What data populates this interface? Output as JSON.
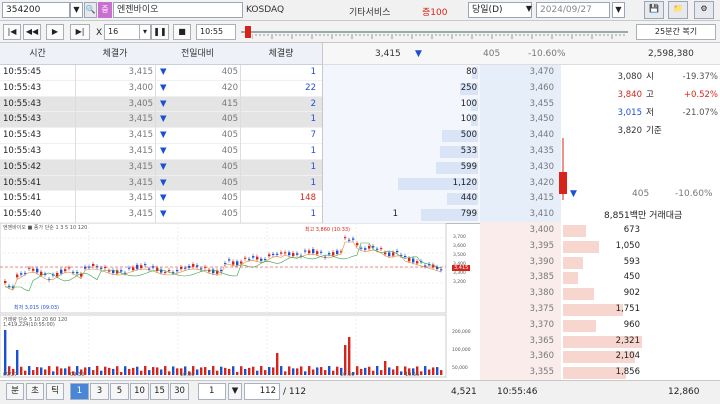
{
  "top": {
    "code": "354200",
    "badge": "중",
    "stock_name": "엔젠바이오",
    "market": "KOSDAQ",
    "sector": "기타서비스",
    "credit": "증100",
    "period": "당일(D)",
    "date": "2024/09/27"
  },
  "ctrl": {
    "multiplier_prefix": "X",
    "multiplier": "16",
    "time_value": "10:55",
    "restore_label": "25분간 복기"
  },
  "ticks": {
    "headers": [
      "시간",
      "체결가",
      "전일대비",
      "체결량"
    ],
    "rows": [
      {
        "time": "10:55:45",
        "price": "3,415",
        "dir": "▼",
        "change": "405",
        "vol": "1",
        "vol_color": "blue"
      },
      {
        "time": "10:55:43",
        "price": "3,400",
        "dir": "▼",
        "change": "420",
        "vol": "22",
        "vol_color": "blue"
      },
      {
        "time": "10:55:43",
        "price": "3,405",
        "dir": "▼",
        "change": "415",
        "vol": "2",
        "vol_color": "blue"
      },
      {
        "time": "10:55:43",
        "price": "3,415",
        "dir": "▼",
        "change": "405",
        "vol": "1",
        "vol_color": "blue"
      },
      {
        "time": "10:55:43",
        "price": "3,415",
        "dir": "▼",
        "change": "405",
        "vol": "7",
        "vol_color": "blue"
      },
      {
        "time": "10:55:43",
        "price": "3,415",
        "dir": "▼",
        "change": "405",
        "vol": "1",
        "vol_color": "blue"
      },
      {
        "time": "10:55:42",
        "price": "3,415",
        "dir": "▼",
        "change": "405",
        "vol": "1",
        "vol_color": "blue"
      },
      {
        "time": "10:55:41",
        "price": "3,415",
        "dir": "▼",
        "change": "405",
        "vol": "1",
        "vol_color": "blue"
      },
      {
        "time": "10:55:41",
        "price": "3,415",
        "dir": "▼",
        "change": "405",
        "vol": "148",
        "vol_color": "red"
      },
      {
        "time": "10:55:40",
        "price": "3,415",
        "dir": "▼",
        "change": "405",
        "vol": "1",
        "vol_color": "blue"
      }
    ]
  },
  "orderbook": {
    "header": {
      "price": "3,415",
      "dir": "▼",
      "change": "405",
      "rate": "-10.60%",
      "volume": "2,598,380"
    },
    "asks": [
      {
        "qty": "80",
        "price": "3,470",
        "pct": 0.07
      },
      {
        "qty": "250",
        "price": "3,460",
        "pct": 0.22
      },
      {
        "qty": "100",
        "price": "3,455",
        "pct": 0.09
      },
      {
        "qty": "100",
        "price": "3,450",
        "pct": 0.09
      },
      {
        "qty": "500",
        "price": "3,440",
        "pct": 0.45
      },
      {
        "qty": "533",
        "price": "3,435",
        "pct": 0.48
      },
      {
        "qty": "599",
        "price": "3,430",
        "pct": 0.53
      },
      {
        "qty": "1,120",
        "price": "3,420",
        "pct": 1.0
      },
      {
        "qty": "440",
        "price": "3,415",
        "pct": 0.39
      },
      {
        "qty": "799",
        "price": "3,410",
        "pct": 0.71,
        "left_qty": "1"
      }
    ],
    "bids": [
      {
        "price": "3,400",
        "qty": "673",
        "pct": 0.29
      },
      {
        "price": "3,395",
        "qty": "1,050",
        "pct": 0.45
      },
      {
        "price": "3,390",
        "qty": "593",
        "pct": 0.25
      },
      {
        "price": "3,385",
        "qty": "450",
        "pct": 0.19
      },
      {
        "price": "3,380",
        "qty": "902",
        "pct": 0.39
      },
      {
        "price": "3,375",
        "qty": "1,751",
        "pct": 0.75
      },
      {
        "price": "3,370",
        "qty": "960",
        "pct": 0.41
      },
      {
        "price": "3,365",
        "qty": "2,321",
        "pct": 0.99
      },
      {
        "price": "3,360",
        "qty": "2,104",
        "pct": 0.9
      },
      {
        "price": "3,355",
        "qty": "1,856",
        "pct": 0.79
      }
    ],
    "info": [
      {
        "value": "3,080",
        "label": "시",
        "rate": "-19.37%"
      },
      {
        "value": "3,840",
        "label": "고",
        "rate": "+0.52%"
      },
      {
        "value": "3,015",
        "label": "저",
        "rate": "-21.07%"
      },
      {
        "value": "3,820",
        "label": "기준",
        "rate": ""
      }
    ],
    "low_dir": "▼",
    "low_change": "405",
    "low_rate": "-10.60%",
    "amount": "8,851백만 거래대금",
    "footer": {
      "ask_total": "4,521",
      "time": "10:55:46",
      "bid_total": "12,860"
    }
  },
  "chart": {
    "legend": "엔젠바이오 ■ 종가 단순 1 3 5 10 120",
    "high_label": "최고 3,860 (10:33)",
    "low_label": "최저 3,015 (09:03)",
    "vol_legend": "거래량 단순 5 10 20 60 120",
    "vol_sub": "1,419,224(10:55:00)",
    "price_ticks": [
      "3,700",
      "3,600",
      "3,500",
      "3,400",
      "3,300",
      "3,200"
    ],
    "cur_tag": "3,415",
    "vol_ticks": [
      "200,000",
      "100,000",
      "50,000"
    ],
    "x_labels": [
      "09/27",
      "09:30",
      "10:00",
      "10:30",
      "10:55"
    ]
  },
  "chart_data": {
    "type": "candlestick",
    "categories": [
      "09/27",
      "09:30",
      "10:00",
      "10:30",
      "10:55"
    ]
  },
  "footer": {
    "tabs": [
      "분",
      "초",
      "틱"
    ],
    "intervals": [
      "1",
      "3",
      "5",
      "10",
      "15",
      "30"
    ],
    "interval_value": "1",
    "page": "112",
    "page_total": "/ 112"
  }
}
